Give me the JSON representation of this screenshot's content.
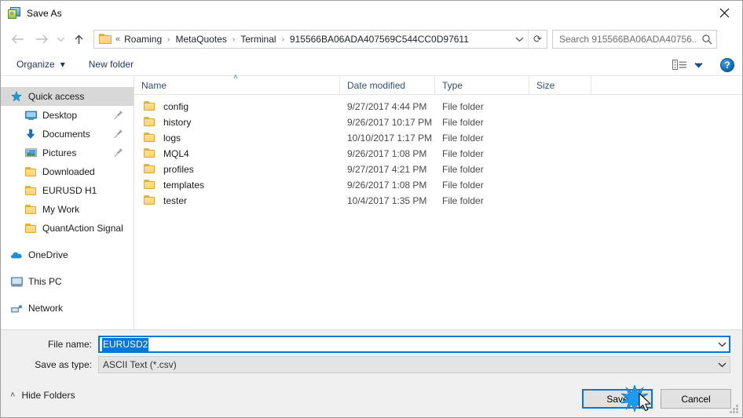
{
  "window": {
    "title": "Save As",
    "icon": "save-as-app-icon",
    "close_label": "✕"
  },
  "nav": {
    "back_icon": "arrow-left-icon",
    "forward_icon": "arrow-right-icon",
    "recent_icon": "chevron-down-icon",
    "up_icon": "arrow-up-icon",
    "address": {
      "folder_icon": "folder-icon",
      "overflow": "«",
      "crumbs": [
        "Roaming",
        "MetaQuotes",
        "Terminal",
        "915566BA06ADA407569C544CC0D97611"
      ],
      "separator": "›",
      "dropdown_icon": "chevron-down-icon",
      "refresh_icon": "⟳"
    },
    "search": {
      "placeholder": "Search 915566BA06ADA40756...",
      "value": "",
      "icon": "search-icon"
    }
  },
  "commandbar": {
    "organize_label": "Organize",
    "organize_caret": "▾",
    "new_folder_label": "New folder",
    "view_mode_icon": "view-list-icon",
    "view_caret": "▾",
    "help_label": "?"
  },
  "sidebar": {
    "items": [
      {
        "label": "Quick access",
        "icon": "star-icon",
        "level": 0,
        "selected": true,
        "pinned": false
      },
      {
        "label": "Desktop",
        "icon": "desktop-icon",
        "level": 1,
        "selected": false,
        "pinned": true
      },
      {
        "label": "Documents",
        "icon": "documents-download-icon",
        "level": 1,
        "selected": false,
        "pinned": true
      },
      {
        "label": "Pictures",
        "icon": "pictures-icon",
        "level": 1,
        "selected": false,
        "pinned": true
      },
      {
        "label": "Downloaded",
        "icon": "folder-icon",
        "level": 1,
        "selected": false,
        "pinned": false
      },
      {
        "label": "EURUSD H1",
        "icon": "folder-icon",
        "level": 1,
        "selected": false,
        "pinned": false
      },
      {
        "label": "My Work",
        "icon": "folder-icon",
        "level": 1,
        "selected": false,
        "pinned": false
      },
      {
        "label": "QuantAction Signal",
        "icon": "folder-icon",
        "level": 1,
        "selected": false,
        "pinned": false
      },
      {
        "label": "OneDrive",
        "icon": "cloud-icon",
        "level": 0,
        "selected": false,
        "pinned": false,
        "gap_before": true
      },
      {
        "label": "This PC",
        "icon": "computer-icon",
        "level": 0,
        "selected": false,
        "pinned": false,
        "gap_before": true
      },
      {
        "label": "Network",
        "icon": "network-icon",
        "level": 0,
        "selected": false,
        "pinned": false,
        "gap_before": true
      }
    ]
  },
  "filelist": {
    "columns": [
      "Name",
      "Date modified",
      "Type",
      "Size"
    ],
    "sort_caret": "˄",
    "rows": [
      {
        "name": "config",
        "date": "9/27/2017 4:44 PM",
        "type": "File folder",
        "size": ""
      },
      {
        "name": "history",
        "date": "9/26/2017 10:17 PM",
        "type": "File folder",
        "size": ""
      },
      {
        "name": "logs",
        "date": "10/10/2017 1:17 PM",
        "type": "File folder",
        "size": ""
      },
      {
        "name": "MQL4",
        "date": "9/26/2017 1:08 PM",
        "type": "File folder",
        "size": ""
      },
      {
        "name": "profiles",
        "date": "9/27/2017 4:21 PM",
        "type": "File folder",
        "size": ""
      },
      {
        "name": "templates",
        "date": "9/26/2017 1:08 PM",
        "type": "File folder",
        "size": ""
      },
      {
        "name": "tester",
        "date": "10/4/2017 1:35 PM",
        "type": "File folder",
        "size": ""
      }
    ]
  },
  "form": {
    "filename_label": "File name:",
    "filename_value": "EURUSD2",
    "filename_placeholder": "",
    "filetype_label": "Save as type:",
    "filetype_value": "ASCII Text (*.csv)",
    "dropdown_icon": "chevron-down-icon"
  },
  "footer": {
    "hide_folders_label": "Hide Folders",
    "hide_folders_caret": "˄",
    "save_label": "Save",
    "cancel_label": "Cancel",
    "resize_grip_icon": "resize-grip-icon"
  },
  "colors": {
    "accent": "#0078d7",
    "selection": "#0078d7",
    "sidebar_selected": "#d8d8d8",
    "dialog_bg": "#f0f0f0",
    "crumb_text": "#20262d",
    "column_header_text": "#34506e",
    "folder_yellow": "#fdd271"
  }
}
